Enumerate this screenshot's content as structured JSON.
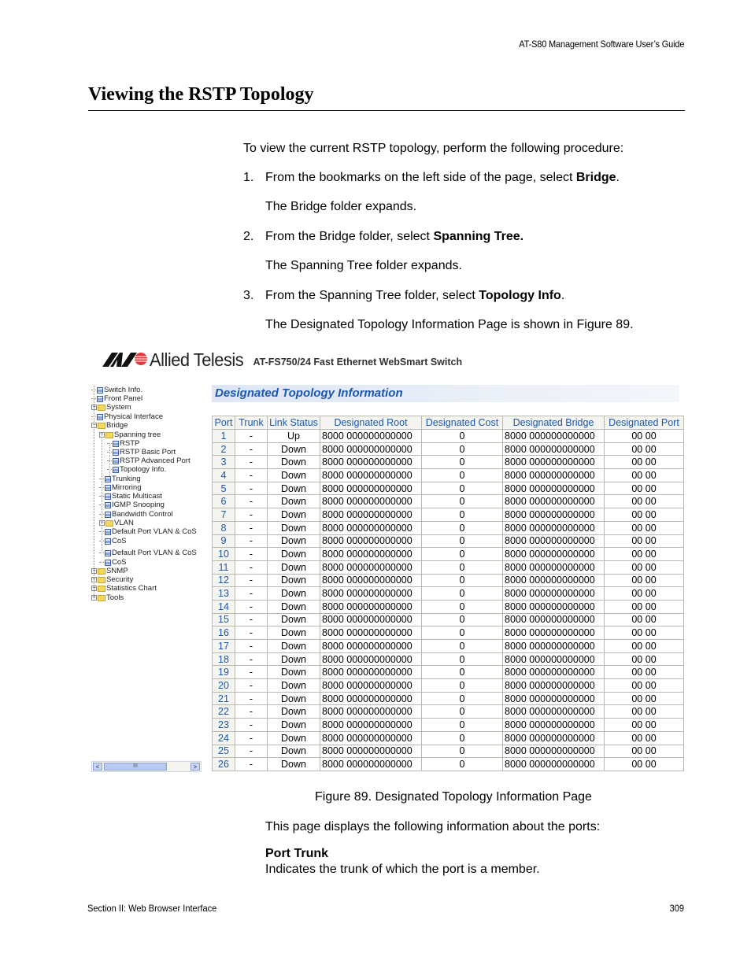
{
  "header": {
    "running_title": "AT-S80 Management Software User’s Guide"
  },
  "section": {
    "title": "Viewing the RSTP Topology"
  },
  "intro": "To view the current RSTP topology, perform the following procedure:",
  "steps": [
    {
      "num": "1.",
      "pre": "From the bookmarks on the left side of the page, select ",
      "bold": "Bridge",
      "post": ".",
      "result": "The Bridge folder expands."
    },
    {
      "num": "2.",
      "pre": "From the Bridge folder, select ",
      "bold": "Spanning Tree.",
      "post": "",
      "result": "The Spanning Tree folder expands."
    },
    {
      "num": "3.",
      "pre": "From the Spanning Tree folder, select ",
      "bold": "Topology Info",
      "post": ".",
      "result": "The Designated Topology Information Page is shown in Figure 89."
    }
  ],
  "figure": {
    "brand": "Allied Telesis",
    "product": "AT-FS750/24 Fast Ethernet WebSmart Switch",
    "tree": [
      {
        "label": "Switch Info.",
        "type": "doc",
        "level": 0,
        "expander": "none"
      },
      {
        "label": "Front Panel",
        "type": "doc",
        "level": 0,
        "expander": "none"
      },
      {
        "label": "System",
        "type": "folder",
        "level": 0,
        "expander": "plus"
      },
      {
        "label": "Physical Interface",
        "type": "doc",
        "level": 0,
        "expander": "none"
      },
      {
        "label": "Bridge",
        "type": "folder-open",
        "level": 0,
        "expander": "minus"
      },
      {
        "label": "Spanning tree",
        "type": "folder-open",
        "level": 1,
        "expander": "minus"
      },
      {
        "label": "RSTP",
        "type": "doc",
        "level": 2,
        "expander": "none"
      },
      {
        "label": "RSTP Basic Port",
        "type": "doc",
        "level": 2,
        "expander": "none"
      },
      {
        "label": "RSTP Advanced Port",
        "type": "doc",
        "level": 2,
        "expander": "none"
      },
      {
        "label": "Topology Info.",
        "type": "doc",
        "level": 2,
        "expander": "none"
      },
      {
        "label": "Trunking",
        "type": "doc",
        "level": 1,
        "expander": "none"
      },
      {
        "label": "Mirroring",
        "type": "doc",
        "level": 1,
        "expander": "none"
      },
      {
        "label": "Static Multicast",
        "type": "doc",
        "level": 1,
        "expander": "none"
      },
      {
        "label": "IGMP Snooping",
        "type": "doc",
        "level": 1,
        "expander": "none"
      },
      {
        "label": "Bandwidth Control",
        "type": "doc",
        "level": 1,
        "expander": "none"
      },
      {
        "label": "VLAN",
        "type": "folder",
        "level": 1,
        "expander": "plus"
      },
      {
        "label": "Default Port VLAN & CoS",
        "type": "doc",
        "level": 1,
        "expander": "none"
      },
      {
        "label": "CoS",
        "type": "doc",
        "level": 1,
        "expander": "none"
      },
      {
        "label": "Default Port VLAN & CoS",
        "type": "doc",
        "level": 1,
        "expander": "none"
      },
      {
        "label": "CoS",
        "type": "doc",
        "level": 1,
        "expander": "none"
      },
      {
        "label": "SNMP",
        "type": "folder",
        "level": 0,
        "expander": "plus"
      },
      {
        "label": "Security",
        "type": "folder",
        "level": 0,
        "expander": "plus"
      },
      {
        "label": "Statistics Chart",
        "type": "folder",
        "level": 0,
        "expander": "plus"
      },
      {
        "label": "Tools",
        "type": "folder",
        "level": 0,
        "expander": "plus"
      }
    ],
    "scrollbar": {
      "left": "<",
      "right": ">",
      "grip": "III"
    },
    "panel_title": "Designated Topology Information",
    "table": {
      "columns": [
        "Port",
        "Trunk",
        "Link Status",
        "Designated Root",
        "Designated Cost",
        "Designated Bridge",
        "Designated Port"
      ],
      "rows": [
        [
          "1",
          "-",
          "Up",
          "8000 000000000000",
          "0",
          "8000 000000000000",
          "00 00"
        ],
        [
          "2",
          "-",
          "Down",
          "8000 000000000000",
          "0",
          "8000 000000000000",
          "00 00"
        ],
        [
          "3",
          "-",
          "Down",
          "8000 000000000000",
          "0",
          "8000 000000000000",
          "00 00"
        ],
        [
          "4",
          "-",
          "Down",
          "8000 000000000000",
          "0",
          "8000 000000000000",
          "00 00"
        ],
        [
          "5",
          "-",
          "Down",
          "8000 000000000000",
          "0",
          "8000 000000000000",
          "00 00"
        ],
        [
          "6",
          "-",
          "Down",
          "8000 000000000000",
          "0",
          "8000 000000000000",
          "00 00"
        ],
        [
          "7",
          "-",
          "Down",
          "8000 000000000000",
          "0",
          "8000 000000000000",
          "00 00"
        ],
        [
          "8",
          "-",
          "Down",
          "8000 000000000000",
          "0",
          "8000 000000000000",
          "00 00"
        ],
        [
          "9",
          "-",
          "Down",
          "8000 000000000000",
          "0",
          "8000 000000000000",
          "00 00"
        ],
        [
          "10",
          "-",
          "Down",
          "8000 000000000000",
          "0",
          "8000 000000000000",
          "00 00"
        ],
        [
          "11",
          "-",
          "Down",
          "8000 000000000000",
          "0",
          "8000 000000000000",
          "00 00"
        ],
        [
          "12",
          "-",
          "Down",
          "8000 000000000000",
          "0",
          "8000 000000000000",
          "00 00"
        ],
        [
          "13",
          "-",
          "Down",
          "8000 000000000000",
          "0",
          "8000 000000000000",
          "00 00"
        ],
        [
          "14",
          "-",
          "Down",
          "8000 000000000000",
          "0",
          "8000 000000000000",
          "00 00"
        ],
        [
          "15",
          "-",
          "Down",
          "8000 000000000000",
          "0",
          "8000 000000000000",
          "00 00"
        ],
        [
          "16",
          "-",
          "Down",
          "8000 000000000000",
          "0",
          "8000 000000000000",
          "00 00"
        ],
        [
          "17",
          "-",
          "Down",
          "8000 000000000000",
          "0",
          "8000 000000000000",
          "00 00"
        ],
        [
          "18",
          "-",
          "Down",
          "8000 000000000000",
          "0",
          "8000 000000000000",
          "00 00"
        ],
        [
          "19",
          "-",
          "Down",
          "8000 000000000000",
          "0",
          "8000 000000000000",
          "00 00"
        ],
        [
          "20",
          "-",
          "Down",
          "8000 000000000000",
          "0",
          "8000 000000000000",
          "00 00"
        ],
        [
          "21",
          "-",
          "Down",
          "8000 000000000000",
          "0",
          "8000 000000000000",
          "00 00"
        ],
        [
          "22",
          "-",
          "Down",
          "8000 000000000000",
          "0",
          "8000 000000000000",
          "00 00"
        ],
        [
          "23",
          "-",
          "Down",
          "8000 000000000000",
          "0",
          "8000 000000000000",
          "00 00"
        ],
        [
          "24",
          "-",
          "Down",
          "8000 000000000000",
          "0",
          "8000 000000000000",
          "00 00"
        ],
        [
          "25",
          "-",
          "Down",
          "8000 000000000000",
          "0",
          "8000 000000000000",
          "00 00"
        ],
        [
          "26",
          "-",
          "Down",
          "8000 000000000000",
          "0",
          "8000 000000000000",
          "00 00"
        ]
      ]
    },
    "caption": "Figure 89. Designated Topology Information Page"
  },
  "after": {
    "intro": "This page displays the following information about the ports:",
    "term": "Port Trunk",
    "definition": "Indicates the trunk of which the port is a member."
  },
  "footer": {
    "section": "Section II: Web Browser Interface",
    "page_number": "309"
  }
}
